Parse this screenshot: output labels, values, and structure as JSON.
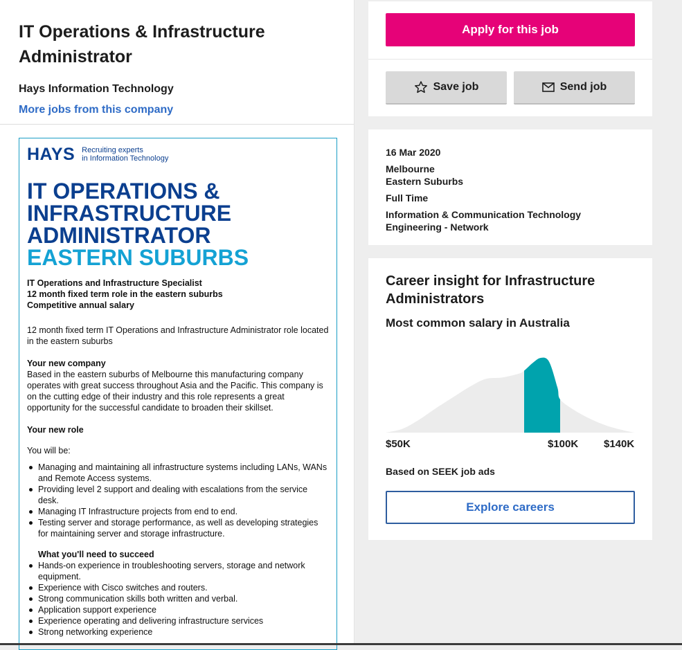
{
  "job": {
    "title": "IT Operations & Infrastructure Administrator",
    "company": "Hays Information Technology",
    "more_jobs": "More jobs from this company"
  },
  "ad": {
    "logo_word": "HAYS",
    "logo_tagline_1": "Recruiting experts",
    "logo_tagline_2": "in Information Technology",
    "title_line_1": "IT OPERATIONS &",
    "title_line_2": "INFRASTRUCTURE",
    "title_line_3": "ADMINISTRATOR",
    "subtitle": "EASTERN SUBURBS",
    "bold_lines": [
      "IT Operations and Infrastructure Specialist",
      "12 month fixed term role in the eastern suburbs",
      "Competitive annual salary"
    ],
    "intro": "12 month fixed term IT Operations and Infrastructure Administrator role located in the eastern suburbs",
    "company_head": "Your new company",
    "company_text": "Based in the eastern suburbs of Melbourne this manufacturing company operates with great success throughout Asia and the Pacific. This company is on the cutting edge of their industry and this role represents a great opportunity for the successful candidate to broaden their skillset.",
    "role_head": "Your new role",
    "you_will_be": "You will be:",
    "role_items": [
      "Managing and maintaining all infrastructure systems including LANs, WANs and Remote Access systems.",
      "Providing level 2 support and dealing with escalations from the service desk.",
      "Managing IT Infrastructure projects from end to end.",
      "Testing server and storage performance, as well as developing strategies for maintaining server and storage infrastructure."
    ],
    "succeed_head": "What you'll need to succeed",
    "succeed_items": [
      "Hands-on experience in troubleshooting servers, storage and network equipment.",
      "Experience with Cisco switches and routers.",
      "Strong communication skills both written and verbal.",
      "Application support experience",
      "Experience operating and delivering infrastructure services",
      "Strong networking experience"
    ]
  },
  "actions": {
    "apply_label": "Apply for this job",
    "save_label": "Save job",
    "send_label": "Send job",
    "apply_color": "#e60278"
  },
  "meta": {
    "date": "16 Mar 2020",
    "location": "Melbourne",
    "area": "Eastern Suburbs",
    "work_type": "Full Time",
    "classification": "Information & Communication Technology",
    "sub_classification": "Engineering - Network"
  },
  "insight": {
    "title": "Career insight for Infrastructure Administrators",
    "subtitle": "Most common salary in Australia",
    "tick_low": "$50K",
    "tick_mid": "$100K",
    "tick_high": "$140K",
    "based_on": "Based on SEEK job ads",
    "explore_label": "Explore careers"
  },
  "chart_data": {
    "type": "area",
    "title": "",
    "xlabel": "",
    "ylabel": "",
    "x_ticks": [
      "$50K",
      "$100K",
      "$140K"
    ],
    "xlim": [
      50,
      140
    ],
    "highlight_range": [
      100,
      113
    ],
    "highlight_color": "#00a3ad",
    "fill_color": "#ececec",
    "x": [
      50,
      56,
      62,
      68,
      74,
      80,
      86,
      92,
      98,
      100,
      103,
      106,
      109,
      112,
      113,
      118,
      124,
      130,
      136,
      140
    ],
    "density": [
      0.0,
      0.05,
      0.17,
      0.32,
      0.46,
      0.6,
      0.71,
      0.73,
      0.78,
      0.82,
      0.92,
      0.99,
      0.94,
      0.6,
      0.44,
      0.3,
      0.18,
      0.09,
      0.03,
      0.0
    ]
  }
}
